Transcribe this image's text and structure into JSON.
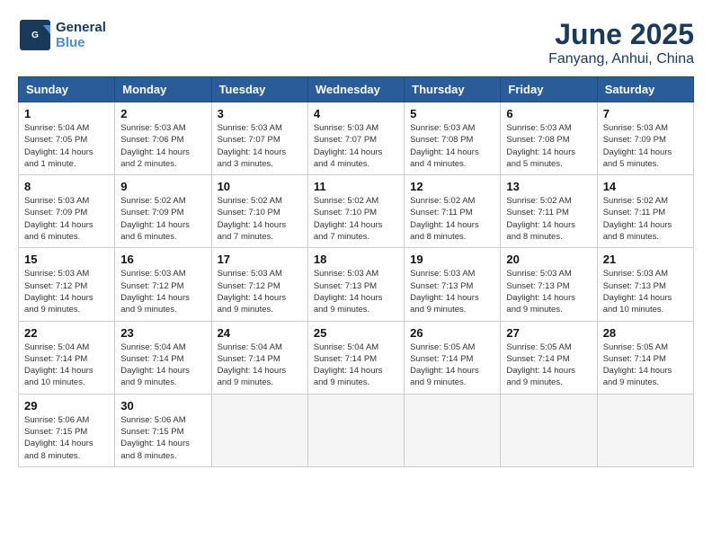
{
  "logo": {
    "general": "General",
    "blue": "Blue"
  },
  "title": "June 2025",
  "location": "Fanyang, Anhui, China",
  "days_of_week": [
    "Sunday",
    "Monday",
    "Tuesday",
    "Wednesday",
    "Thursday",
    "Friday",
    "Saturday"
  ],
  "weeks": [
    [
      {
        "day": "1",
        "info": "Sunrise: 5:04 AM\nSunset: 7:05 PM\nDaylight: 14 hours\nand 1 minute."
      },
      {
        "day": "2",
        "info": "Sunrise: 5:03 AM\nSunset: 7:06 PM\nDaylight: 14 hours\nand 2 minutes."
      },
      {
        "day": "3",
        "info": "Sunrise: 5:03 AM\nSunset: 7:07 PM\nDaylight: 14 hours\nand 3 minutes."
      },
      {
        "day": "4",
        "info": "Sunrise: 5:03 AM\nSunset: 7:07 PM\nDaylight: 14 hours\nand 4 minutes."
      },
      {
        "day": "5",
        "info": "Sunrise: 5:03 AM\nSunset: 7:08 PM\nDaylight: 14 hours\nand 4 minutes."
      },
      {
        "day": "6",
        "info": "Sunrise: 5:03 AM\nSunset: 7:08 PM\nDaylight: 14 hours\nand 5 minutes."
      },
      {
        "day": "7",
        "info": "Sunrise: 5:03 AM\nSunset: 7:09 PM\nDaylight: 14 hours\nand 5 minutes."
      }
    ],
    [
      {
        "day": "8",
        "info": "Sunrise: 5:03 AM\nSunset: 7:09 PM\nDaylight: 14 hours\nand 6 minutes."
      },
      {
        "day": "9",
        "info": "Sunrise: 5:02 AM\nSunset: 7:09 PM\nDaylight: 14 hours\nand 6 minutes."
      },
      {
        "day": "10",
        "info": "Sunrise: 5:02 AM\nSunset: 7:10 PM\nDaylight: 14 hours\nand 7 minutes."
      },
      {
        "day": "11",
        "info": "Sunrise: 5:02 AM\nSunset: 7:10 PM\nDaylight: 14 hours\nand 7 minutes."
      },
      {
        "day": "12",
        "info": "Sunrise: 5:02 AM\nSunset: 7:11 PM\nDaylight: 14 hours\nand 8 minutes."
      },
      {
        "day": "13",
        "info": "Sunrise: 5:02 AM\nSunset: 7:11 PM\nDaylight: 14 hours\nand 8 minutes."
      },
      {
        "day": "14",
        "info": "Sunrise: 5:02 AM\nSunset: 7:11 PM\nDaylight: 14 hours\nand 8 minutes."
      }
    ],
    [
      {
        "day": "15",
        "info": "Sunrise: 5:03 AM\nSunset: 7:12 PM\nDaylight: 14 hours\nand 9 minutes."
      },
      {
        "day": "16",
        "info": "Sunrise: 5:03 AM\nSunset: 7:12 PM\nDaylight: 14 hours\nand 9 minutes."
      },
      {
        "day": "17",
        "info": "Sunrise: 5:03 AM\nSunset: 7:12 PM\nDaylight: 14 hours\nand 9 minutes."
      },
      {
        "day": "18",
        "info": "Sunrise: 5:03 AM\nSunset: 7:13 PM\nDaylight: 14 hours\nand 9 minutes."
      },
      {
        "day": "19",
        "info": "Sunrise: 5:03 AM\nSunset: 7:13 PM\nDaylight: 14 hours\nand 9 minutes."
      },
      {
        "day": "20",
        "info": "Sunrise: 5:03 AM\nSunset: 7:13 PM\nDaylight: 14 hours\nand 9 minutes."
      },
      {
        "day": "21",
        "info": "Sunrise: 5:03 AM\nSunset: 7:13 PM\nDaylight: 14 hours\nand 10 minutes."
      }
    ],
    [
      {
        "day": "22",
        "info": "Sunrise: 5:04 AM\nSunset: 7:14 PM\nDaylight: 14 hours\nand 10 minutes."
      },
      {
        "day": "23",
        "info": "Sunrise: 5:04 AM\nSunset: 7:14 PM\nDaylight: 14 hours\nand 9 minutes."
      },
      {
        "day": "24",
        "info": "Sunrise: 5:04 AM\nSunset: 7:14 PM\nDaylight: 14 hours\nand 9 minutes."
      },
      {
        "day": "25",
        "info": "Sunrise: 5:04 AM\nSunset: 7:14 PM\nDaylight: 14 hours\nand 9 minutes."
      },
      {
        "day": "26",
        "info": "Sunrise: 5:05 AM\nSunset: 7:14 PM\nDaylight: 14 hours\nand 9 minutes."
      },
      {
        "day": "27",
        "info": "Sunrise: 5:05 AM\nSunset: 7:14 PM\nDaylight: 14 hours\nand 9 minutes."
      },
      {
        "day": "28",
        "info": "Sunrise: 5:05 AM\nSunset: 7:14 PM\nDaylight: 14 hours\nand 9 minutes."
      }
    ],
    [
      {
        "day": "29",
        "info": "Sunrise: 5:06 AM\nSunset: 7:15 PM\nDaylight: 14 hours\nand 8 minutes."
      },
      {
        "day": "30",
        "info": "Sunrise: 5:06 AM\nSunset: 7:15 PM\nDaylight: 14 hours\nand 8 minutes."
      },
      {
        "day": "",
        "info": ""
      },
      {
        "day": "",
        "info": ""
      },
      {
        "day": "",
        "info": ""
      },
      {
        "day": "",
        "info": ""
      },
      {
        "day": "",
        "info": ""
      }
    ]
  ]
}
